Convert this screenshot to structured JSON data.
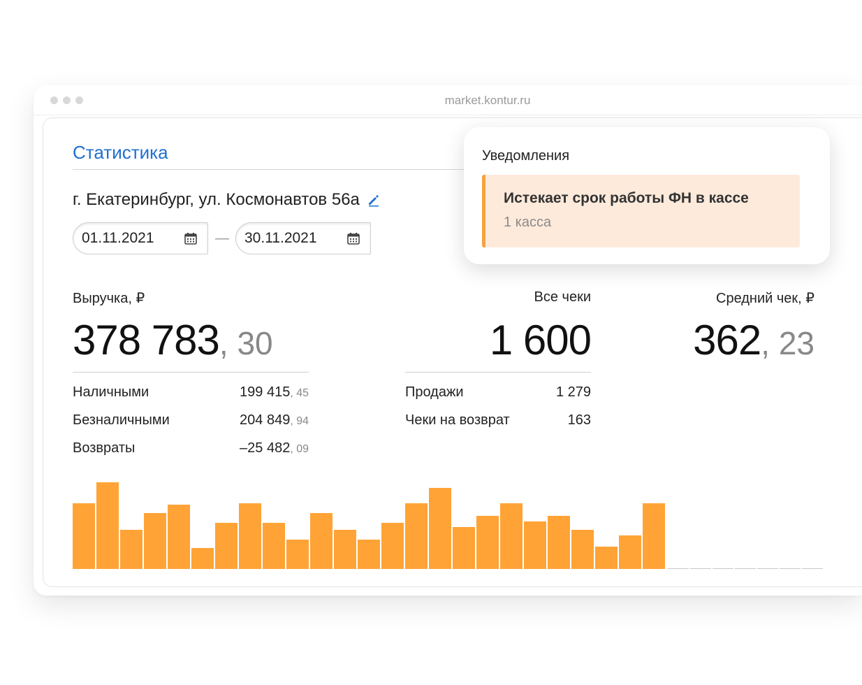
{
  "browser": {
    "url": "market.kontur.ru"
  },
  "page": {
    "title": "Статистика",
    "address": "г. Екатеринбург, ул. Космонавтов 56а",
    "date_from": "01.11.2021",
    "date_to": "30.11.2021",
    "date_separator": "—"
  },
  "revenue": {
    "label": "Выручка, ₽",
    "value_int": "378 783",
    "value_frac": ", 30",
    "rows": [
      {
        "label": "Наличными",
        "int": "199 415",
        "frac": ", 45"
      },
      {
        "label": "Безналичными",
        "int": "204 849",
        "frac": ", 94"
      },
      {
        "label": "Возвраты",
        "int": "–25 482",
        "frac": ", 09"
      }
    ]
  },
  "checks": {
    "label": "Все чеки",
    "value": "1 600",
    "rows": [
      {
        "label": "Продажи",
        "value": "1 279"
      },
      {
        "label": "Чеки на возврат",
        "value": "163"
      }
    ]
  },
  "avg": {
    "label": "Средний чек, ₽",
    "value_int": "362",
    "value_frac": ", 23"
  },
  "notification": {
    "title": "Уведомления",
    "heading": "Истекает срок работы ФН в кассе",
    "sub": "1 касса"
  },
  "chart_data": {
    "type": "bar",
    "color": "#ffa336",
    "values": [
      94,
      124,
      56,
      80,
      92,
      30,
      66,
      94,
      66,
      42,
      80,
      56,
      42,
      66,
      94,
      116,
      60,
      76,
      94,
      68,
      76,
      56,
      32,
      48,
      94
    ],
    "empty_slots": 7
  }
}
